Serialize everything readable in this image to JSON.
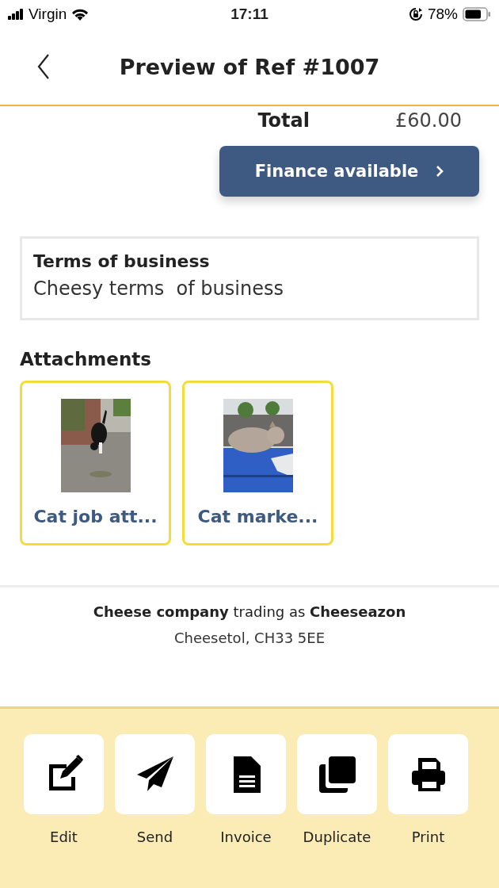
{
  "status_bar": {
    "carrier": "Virgin",
    "time": "17:11",
    "battery": "78%"
  },
  "header": {
    "title": "Preview of Ref #1007"
  },
  "total": {
    "label": "Total",
    "value": "£60.00"
  },
  "finance_button": {
    "label": "Finance available"
  },
  "terms": {
    "title": "Terms of business",
    "text": "Cheesy terms  of business"
  },
  "attachments": {
    "title": "Attachments",
    "items": [
      {
        "name": "Cat job att...",
        "kind": "picture"
      },
      {
        "name": "Cat marke...",
        "kind": "picture"
      }
    ]
  },
  "footer": {
    "company": "**Cheese company** trading as **Cheeseazon**",
    "address": "Cheesetol, CH33 5EE"
  },
  "actions": [
    {
      "kind": "edit",
      "label": "Edit"
    },
    {
      "kind": "send",
      "label": "Send"
    },
    {
      "kind": "invoice",
      "label": "Invoice"
    },
    {
      "kind": "duplicate",
      "label": "Duplicate"
    },
    {
      "kind": "print",
      "label": "Print"
    }
  ]
}
